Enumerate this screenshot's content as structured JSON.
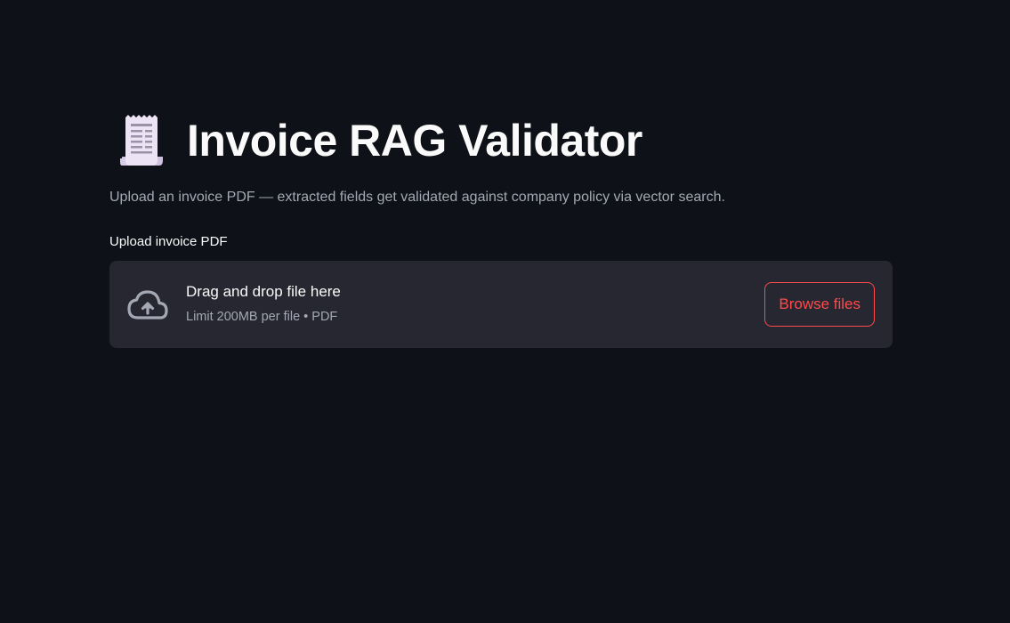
{
  "page": {
    "title_icon": "receipt-icon",
    "title": "Invoice RAG Validator",
    "subtitle": "Upload an invoice PDF — extracted fields get validated against company policy via vector search."
  },
  "uploader": {
    "label": "Upload invoice PDF",
    "icon": "cloud-upload-icon",
    "drop_text": "Drag and drop file here",
    "limit_text": "Limit 200MB per file • PDF",
    "browse_label": "Browse files"
  },
  "colors": {
    "background": "#0e1117",
    "dropzone": "#262730",
    "accent": "#ff4b4b",
    "muted_text": "#a3a8b4",
    "text": "#fafafa"
  }
}
